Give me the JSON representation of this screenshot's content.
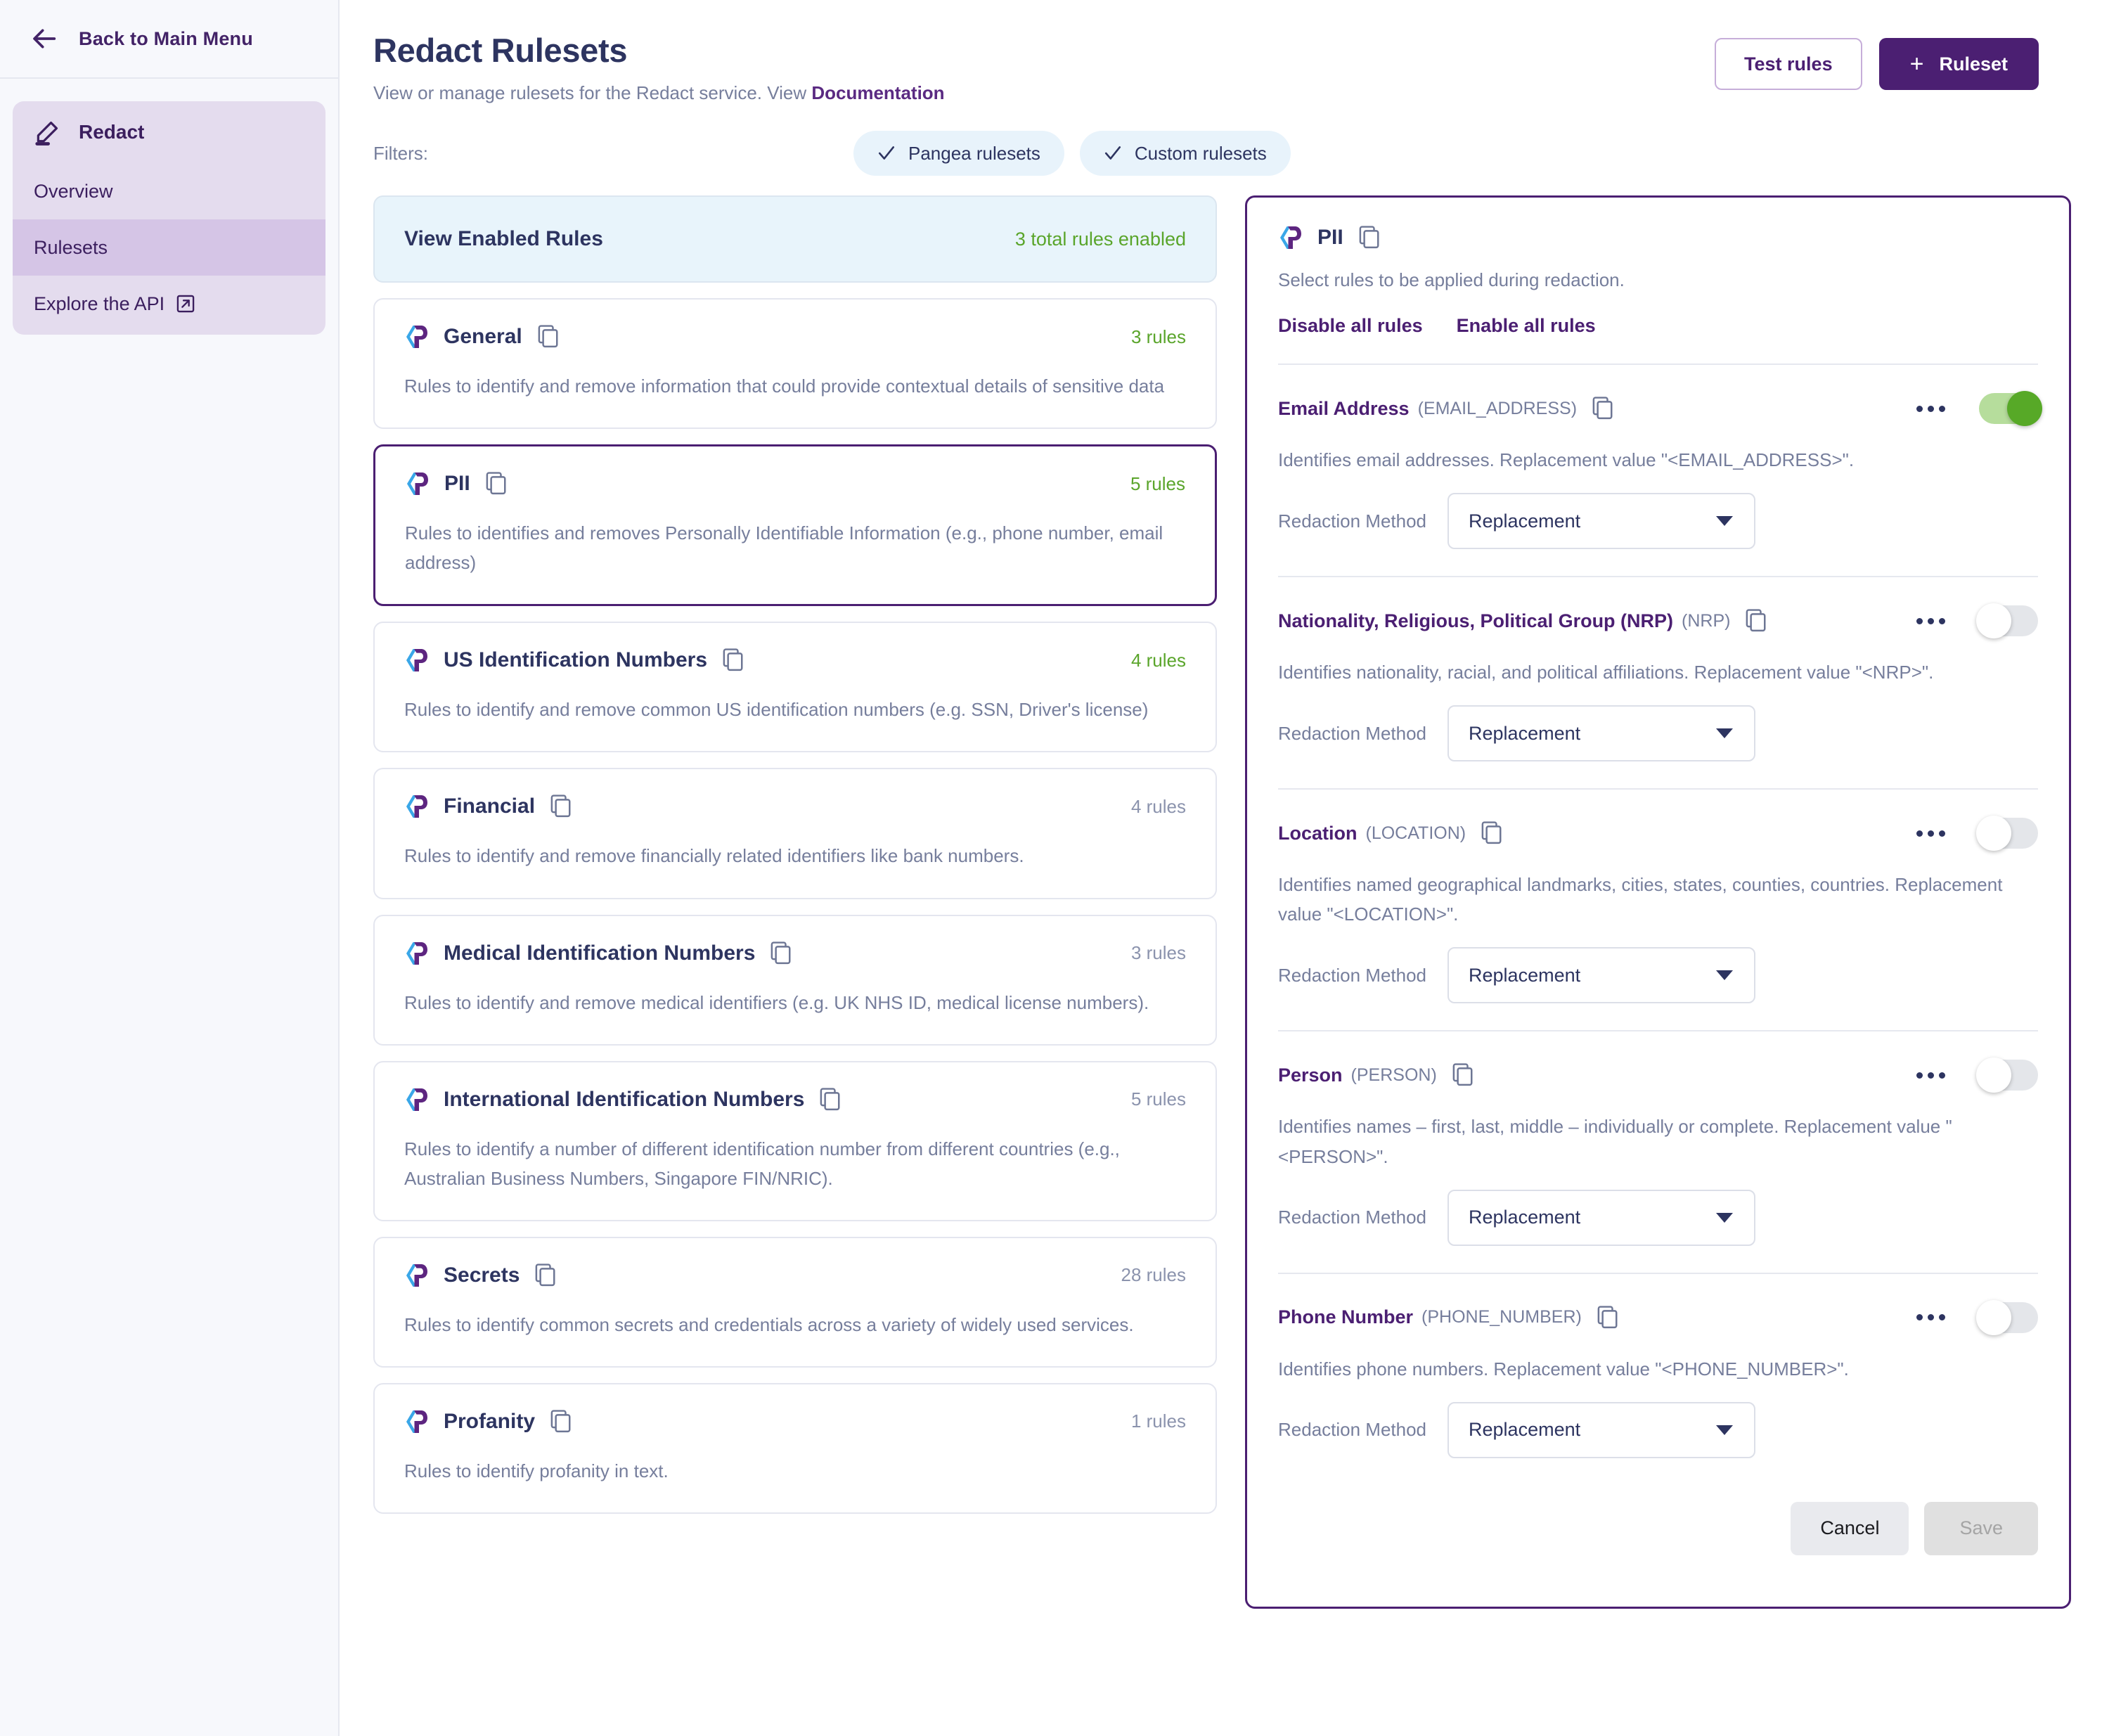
{
  "sidebar": {
    "back_label": "Back to Main Menu",
    "service_label": "Redact",
    "items": [
      {
        "label": "Overview",
        "active": false,
        "external": false
      },
      {
        "label": "Rulesets",
        "active": true,
        "external": false
      },
      {
        "label": "Explore the API",
        "active": false,
        "external": true
      }
    ]
  },
  "header": {
    "title": "Redact Rulesets",
    "subtitle_prefix": "View or manage rulesets for the Redact service. View ",
    "doc_link": "Documentation",
    "test_rules_label": "Test rules",
    "add_ruleset_label": "Ruleset",
    "add_ruleset_plus": "+"
  },
  "filters": {
    "label": "Filters:",
    "chips": [
      {
        "label": "Pangea rulesets",
        "checked": true
      },
      {
        "label": "Custom rulesets",
        "checked": true
      }
    ]
  },
  "enabled_banner": {
    "title": "View Enabled Rules",
    "count_text": "3 total rules enabled"
  },
  "rulesets": [
    {
      "name": "General",
      "count": "3 rules",
      "count_enabled": true,
      "description": "Rules to identify and remove information that could provide contextual details of sensitive data",
      "selected": false
    },
    {
      "name": "PII",
      "count": "5 rules",
      "count_enabled": true,
      "description": "Rules to identifies and removes Personally Identifiable Information (e.g., phone number, email address)",
      "selected": true
    },
    {
      "name": "US Identification Numbers",
      "count": "4 rules",
      "count_enabled": true,
      "description": "Rules to identify and remove common US identification numbers (e.g. SSN, Driver's license)",
      "selected": false
    },
    {
      "name": "Financial",
      "count": "4 rules",
      "count_enabled": false,
      "description": "Rules to identify and remove financially related identifiers like bank numbers.",
      "selected": false
    },
    {
      "name": "Medical Identification Numbers",
      "count": "3 rules",
      "count_enabled": false,
      "description": "Rules to identify and remove medical identifiers (e.g. UK NHS ID, medical license numbers).",
      "selected": false
    },
    {
      "name": "International Identification Numbers",
      "count": "5 rules",
      "count_enabled": false,
      "description": "Rules to identify a number of different identification number from different countries (e.g., Australian Business Numbers, Singapore FIN/NRIC).",
      "selected": false
    },
    {
      "name": "Secrets",
      "count": "28 rules",
      "count_enabled": false,
      "description": "Rules to identify common secrets and credentials across a variety of widely used services.",
      "selected": false
    },
    {
      "name": "Profanity",
      "count": "1 rules",
      "count_enabled": false,
      "description": "Rules to identify profanity in text.",
      "selected": false
    }
  ],
  "detail": {
    "title": "PII",
    "subtitle": "Select rules to be applied during redaction.",
    "disable_all_label": "Disable all rules",
    "enable_all_label": "Enable all rules",
    "method_label": "Redaction Method",
    "cancel_label": "Cancel",
    "save_label": "Save",
    "rules": [
      {
        "name": "Email Address",
        "key": "(EMAIL_ADDRESS)",
        "description": "Identifies email addresses. Replacement value \"<EMAIL_ADDRESS>\".",
        "method": "Replacement",
        "enabled": true
      },
      {
        "name": "Nationality, Religious, Political Group (NRP)",
        "key": "(NRP)",
        "description": "Identifies nationality, racial, and political affiliations. Replacement value \"<NRP>\".",
        "method": "Replacement",
        "enabled": false
      },
      {
        "name": "Location",
        "key": "(LOCATION)",
        "description": "Identifies named geographical landmarks, cities, states, counties, countries. Replacement value \"<LOCATION>\".",
        "method": "Replacement",
        "enabled": false
      },
      {
        "name": "Person",
        "key": "(PERSON)",
        "description": "Identifies names – first, last, middle – individually or complete. Replacement value \"<PERSON>\".",
        "method": "Replacement",
        "enabled": false
      },
      {
        "name": "Phone Number",
        "key": "(PHONE_NUMBER)",
        "description": "Identifies phone numbers. Replacement value \"<PHONE_NUMBER>\".",
        "method": "Replacement",
        "enabled": false
      }
    ]
  },
  "colors": {
    "brand_purple": "#4b1f72",
    "accent_green": "#5aa52b",
    "toggle_on": "#57a927",
    "navy": "#2d3460",
    "muted": "#767e9c",
    "sidebar_bg": "#f7f8fc",
    "nav_active": "#d5c5e6",
    "banner_bg": "#e8f4fb",
    "logo_blue": "#3aa7e8",
    "logo_purple": "#5d2580"
  }
}
